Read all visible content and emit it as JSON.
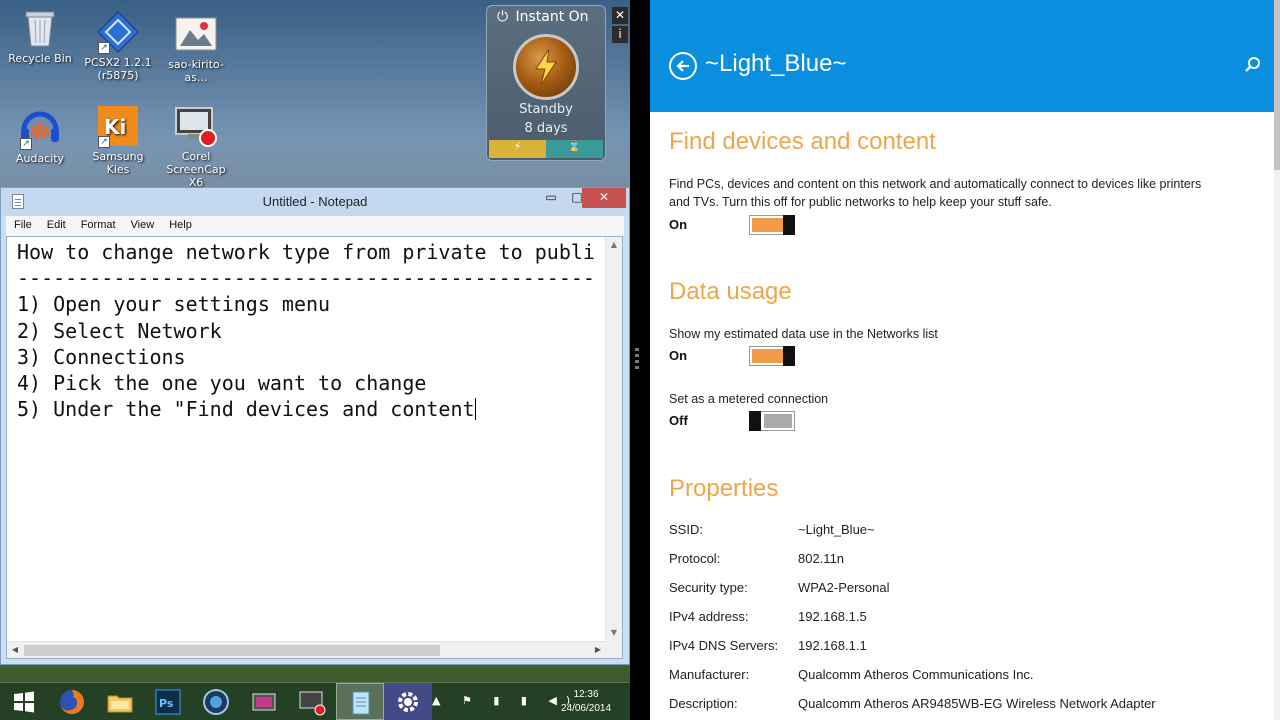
{
  "desktop": {
    "icons": [
      {
        "label": "Recycle Bin",
        "icon": "recycle-bin-icon"
      },
      {
        "label": "PCSX2 1.2.1 (r5875)",
        "icon": "pcsx2-icon"
      },
      {
        "label": "sao-kirito-as...",
        "icon": "image-file-icon"
      },
      {
        "label": "Audacity",
        "icon": "audacity-icon"
      },
      {
        "label": "Samsung Kies",
        "icon": "samsung-kies-icon"
      },
      {
        "label": "Corel ScreenCap X6",
        "icon": "corel-screencap-icon"
      }
    ],
    "gadget": {
      "title": "Instant On",
      "status": "Standby",
      "duration": "8 days",
      "close_glyph": "✕",
      "info_glyph": "i"
    }
  },
  "notepad": {
    "title": "Untitled - Notepad",
    "menu": [
      "File",
      "Edit",
      "Format",
      "View",
      "Help"
    ],
    "lines": [
      "How to change network type from private to publi",
      "------------------------------------------------",
      "",
      "1) Open your settings menu",
      "2) Select Network",
      "3) Connections",
      "4) Pick the one you want to change",
      "5) Under the \"Find devices and content"
    ],
    "window_buttons": {
      "min": "▭",
      "max": "□",
      "close": "✕"
    }
  },
  "taskbar": {
    "items": [
      "windows-start-icon",
      "firefox-icon",
      "file-explorer-icon",
      "photoshop-icon",
      "app-icon",
      "video-editor-icon",
      "screencap-icon",
      "notepad-icon",
      "settings-icon"
    ],
    "clock_time": "12:36",
    "clock_date": "24/06/2014",
    "tray_icons": "▲ ⚑ ▮ ▮ ◀)"
  },
  "settings": {
    "header_title": "~Light_Blue~",
    "sections": {
      "find_devices": {
        "heading": "Find devices and content",
        "description": "Find PCs, devices and content on this network and automatically connect to devices like printers and TVs. Turn this off for public networks to help keep your stuff safe.",
        "state": "On"
      },
      "data_usage": {
        "heading": "Data usage",
        "show_estimated_label": "Show my estimated data use in the Networks list",
        "show_estimated_state": "On",
        "metered_label": "Set as a metered connection",
        "metered_state": "Off"
      },
      "properties": {
        "heading": "Properties",
        "rows": [
          {
            "key": "SSID:",
            "value": "~Light_Blue~"
          },
          {
            "key": "Protocol:",
            "value": "802.11n"
          },
          {
            "key": "Security type:",
            "value": "WPA2-Personal"
          },
          {
            "key": "IPv4 address:",
            "value": "192.168.1.5"
          },
          {
            "key": "IPv4 DNS Servers:",
            "value": "192.168.1.1"
          },
          {
            "key": "Manufacturer:",
            "value": "Qualcomm Atheros Communications Inc."
          },
          {
            "key": "Description:",
            "value": "Qualcomm Atheros AR9485WB-EG Wireless Network Adapter"
          }
        ]
      }
    }
  },
  "colors": {
    "settings_header": "#0a8ee0",
    "settings_heading": "#f0a54a",
    "toggle_on": "#f29b46",
    "notepad_close": "#c75050"
  }
}
